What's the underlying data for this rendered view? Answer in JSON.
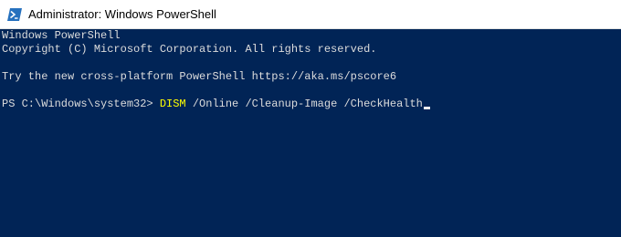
{
  "window": {
    "title": "Administrator: Windows PowerShell",
    "icon": "powershell-icon"
  },
  "console": {
    "background": "#012456",
    "lines": [
      "Windows PowerShell",
      "Copyright (C) Microsoft Corporation. All rights reserved.",
      "",
      "Try the new cross-platform PowerShell https://aka.ms/pscore6",
      ""
    ],
    "prompt": "PS C:\\Windows\\system32> ",
    "command": "DISM",
    "command_args": " /Online /Cleanup-Image /CheckHealth",
    "command_color": "#ffff00"
  }
}
